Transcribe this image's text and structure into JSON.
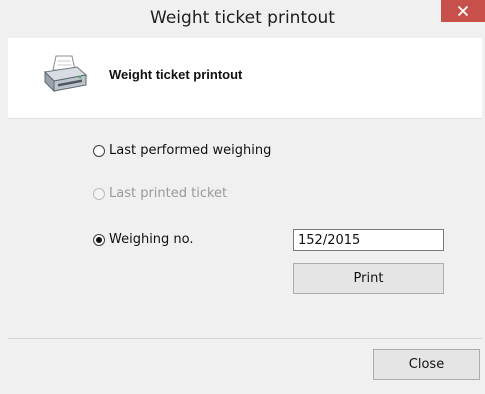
{
  "window": {
    "title": "Weight ticket printout",
    "close_symbol": "×",
    "close_color": "#c7504a"
  },
  "header": {
    "title": "Weight ticket printout",
    "icon": "printer-icon"
  },
  "options": {
    "last_performed": {
      "label": "Last performed weighing",
      "checked": false,
      "enabled": true
    },
    "last_printed": {
      "label": "Last printed ticket",
      "checked": false,
      "enabled": false
    },
    "weighing_no": {
      "label": "Weighing no.",
      "checked": true,
      "enabled": true
    }
  },
  "weighing_input": {
    "value": "152/2015"
  },
  "buttons": {
    "print": "Print",
    "close": "Close"
  }
}
